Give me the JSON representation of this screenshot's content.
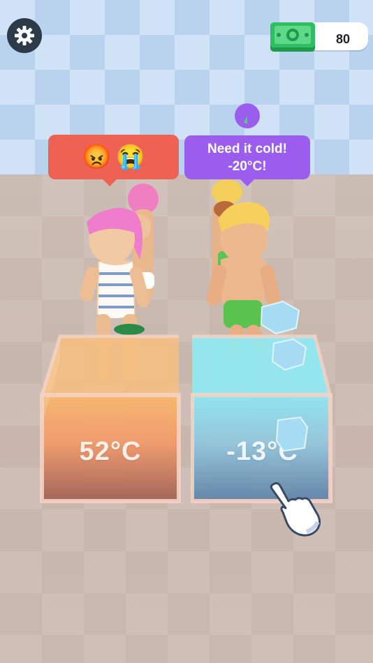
{
  "hud": {
    "settings_icon": "gear-icon",
    "money_icon": "cash-icon",
    "money_value": "80",
    "timer_icon": "pie-timer-icon",
    "timer_progress": 0.05
  },
  "bubbles": {
    "left": {
      "emojis": [
        "😡",
        "😭"
      ]
    },
    "right": {
      "line1": "Need it cold!",
      "line2": "-20°C!"
    }
  },
  "tanks": {
    "left": {
      "temperature": "52°C",
      "color": "#f4a76b"
    },
    "right": {
      "temperature": "-13°C",
      "color": "#8fe3ef"
    }
  },
  "colors": {
    "wall": "#cfe2f6",
    "floor": "#c9b8ae",
    "cash": "#2fbf63",
    "bubble_left": "#ee6153",
    "bubble_right": "#9a5ded"
  }
}
